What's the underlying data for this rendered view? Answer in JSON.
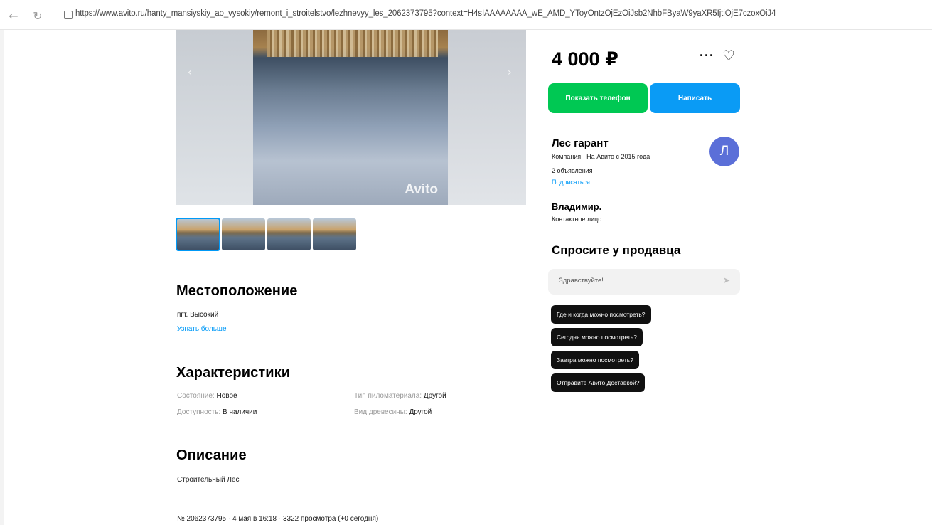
{
  "browser": {
    "url": "https://www.avito.ru/hanty_mansiyskiy_ao_vysokiy/remont_i_stroitelstvo/lezhnevyy_les_2062373795?context=H4sIAAAAAAAA_wE_AMD_YToyOntzOjEzOiJsb2NhbFByaW9yaXR5IjtiOjE7czoxOiJ4"
  },
  "gallery": {
    "watermark": "Avito"
  },
  "location": {
    "title": "Местоположение",
    "address": "пгт. Высокий",
    "more_link": "Узнать больше"
  },
  "specs": {
    "title": "Характеристики",
    "items": [
      {
        "label": "Состояние:",
        "value": "Новое"
      },
      {
        "label": "Доступность:",
        "value": "В наличии"
      },
      {
        "label": "Тип пиломатериала:",
        "value": "Другой"
      },
      {
        "label": "Вид древесины:",
        "value": "Другой"
      }
    ]
  },
  "description": {
    "title": "Описание",
    "text": "Строительный Лес"
  },
  "footer": {
    "meta": "№ 2062373795 · 4 мая в 16:18 · 3322 просмотра (+0 сегодня)"
  },
  "offer": {
    "price": "4 000 ₽",
    "phone_button": "Показать телефон",
    "write_button": "Написать"
  },
  "seller": {
    "name": "Лес гарант",
    "info": "Компания · На Авито с 2015 года",
    "ads": "2 объявления",
    "subscribe": "Подписаться",
    "avatar_letter": "Л",
    "contact_name": "Владимир.",
    "contact_role": "Контактное лицо"
  },
  "ask": {
    "title": "Спросите у продавца",
    "placeholder": "Здравствуйте!",
    "questions": [
      "Где и когда можно посмотреть?",
      "Сегодня можно посмотреть?",
      "Завтра можно посмотреть?",
      "Отправите Авито Доставкой?"
    ]
  },
  "icons": {
    "back": "arrow-left-icon",
    "reload": "reload-icon",
    "lock": "lock-icon",
    "more": "more-dots-icon",
    "favorite": "heart-icon",
    "send": "send-icon"
  },
  "colors": {
    "green": "#00c853",
    "blue": "#0a9bf5",
    "link": "#0099f7",
    "avatar": "#5b6fd8",
    "chip": "#111111"
  }
}
